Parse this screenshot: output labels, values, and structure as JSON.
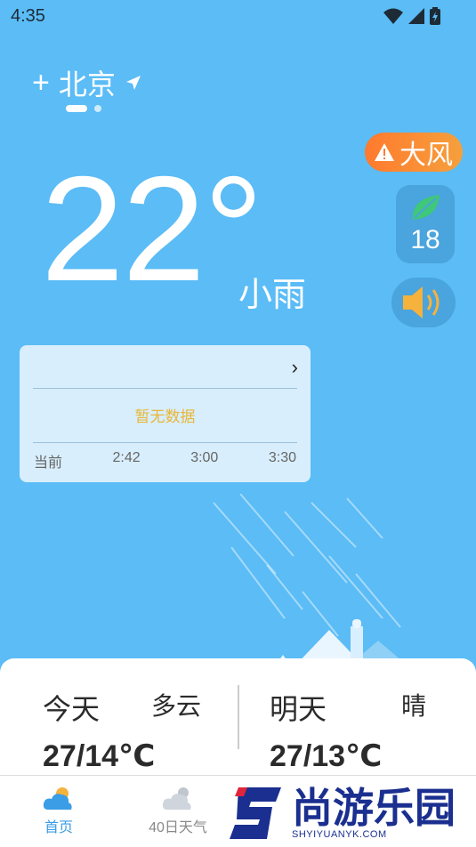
{
  "status_bar": {
    "time": "4:35"
  },
  "location": {
    "city": "北京",
    "add_symbol": "+"
  },
  "current": {
    "temperature": "22°",
    "condition": "小雨"
  },
  "badges": {
    "alert_text": "大风",
    "aqi_value": "18"
  },
  "precip_card": {
    "empty_text": "暂无数据",
    "arrow": "›",
    "times": [
      "当前",
      "2:42",
      "3:00",
      "3:30"
    ]
  },
  "forecast": {
    "today": {
      "label": "今天",
      "condition": "多云",
      "temp": "27/14℃"
    },
    "tomorrow": {
      "label": "明天",
      "condition": "晴",
      "temp": "27/13℃"
    }
  },
  "nav": [
    {
      "label": "首页",
      "icon": "partly-cloudy-icon",
      "active": true
    },
    {
      "label": "40日天气",
      "icon": "cloud-sun-icon",
      "active": false
    }
  ],
  "watermark": {
    "main": "尚游乐园",
    "sub": "SHYIYUANYK.COM"
  },
  "colors": {
    "background": "#5bbcf6",
    "accent": "#3a9de5",
    "alert": "#ff7a2e",
    "empty_text": "#e8b637"
  }
}
